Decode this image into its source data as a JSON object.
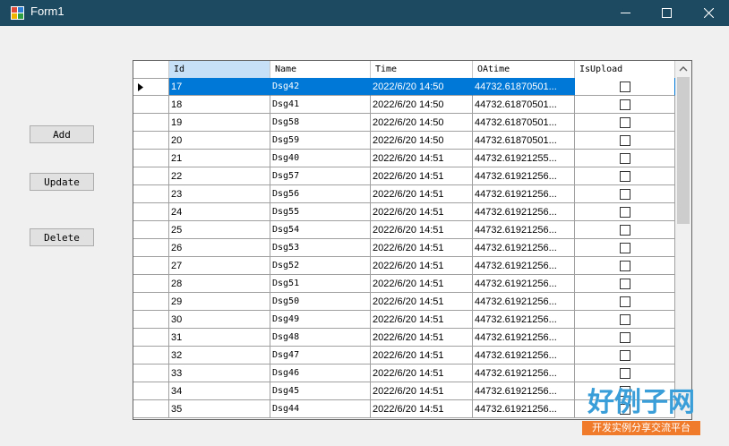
{
  "window": {
    "title": "Form1"
  },
  "buttons": {
    "add": "Add",
    "update": "Update",
    "delete": "Delete"
  },
  "grid": {
    "columns": [
      "Id",
      "Name",
      "Time",
      "OAtime",
      "IsUpload"
    ],
    "rows": [
      {
        "id": "17",
        "name": "Dsg42",
        "time": "2022/6/20 14:50",
        "oatime": "44732.61870501...",
        "isupload": false
      },
      {
        "id": "18",
        "name": "Dsg41",
        "time": "2022/6/20 14:50",
        "oatime": "44732.61870501...",
        "isupload": false
      },
      {
        "id": "19",
        "name": "Dsg58",
        "time": "2022/6/20 14:50",
        "oatime": "44732.61870501...",
        "isupload": false
      },
      {
        "id": "20",
        "name": "Dsg59",
        "time": "2022/6/20 14:50",
        "oatime": "44732.61870501...",
        "isupload": false
      },
      {
        "id": "21",
        "name": "Dsg40",
        "time": "2022/6/20 14:51",
        "oatime": "44732.61921255...",
        "isupload": false
      },
      {
        "id": "22",
        "name": "Dsg57",
        "time": "2022/6/20 14:51",
        "oatime": "44732.61921256...",
        "isupload": false
      },
      {
        "id": "23",
        "name": "Dsg56",
        "time": "2022/6/20 14:51",
        "oatime": "44732.61921256...",
        "isupload": false
      },
      {
        "id": "24",
        "name": "Dsg55",
        "time": "2022/6/20 14:51",
        "oatime": "44732.61921256...",
        "isupload": false
      },
      {
        "id": "25",
        "name": "Dsg54",
        "time": "2022/6/20 14:51",
        "oatime": "44732.61921256...",
        "isupload": false
      },
      {
        "id": "26",
        "name": "Dsg53",
        "time": "2022/6/20 14:51",
        "oatime": "44732.61921256...",
        "isupload": false
      },
      {
        "id": "27",
        "name": "Dsg52",
        "time": "2022/6/20 14:51",
        "oatime": "44732.61921256...",
        "isupload": false
      },
      {
        "id": "28",
        "name": "Dsg51",
        "time": "2022/6/20 14:51",
        "oatime": "44732.61921256...",
        "isupload": false
      },
      {
        "id": "29",
        "name": "Dsg50",
        "time": "2022/6/20 14:51",
        "oatime": "44732.61921256...",
        "isupload": false
      },
      {
        "id": "30",
        "name": "Dsg49",
        "time": "2022/6/20 14:51",
        "oatime": "44732.61921256...",
        "isupload": false
      },
      {
        "id": "31",
        "name": "Dsg48",
        "time": "2022/6/20 14:51",
        "oatime": "44732.61921256...",
        "isupload": false
      },
      {
        "id": "32",
        "name": "Dsg47",
        "time": "2022/6/20 14:51",
        "oatime": "44732.61921256...",
        "isupload": false
      },
      {
        "id": "33",
        "name": "Dsg46",
        "time": "2022/6/20 14:51",
        "oatime": "44732.61921256...",
        "isupload": false
      },
      {
        "id": "34",
        "name": "Dsg45",
        "time": "2022/6/20 14:51",
        "oatime": "44732.61921256...",
        "isupload": false
      },
      {
        "id": "35",
        "name": "Dsg44",
        "time": "2022/6/20 14:51",
        "oatime": "44732.61921256...",
        "isupload": false
      }
    ]
  },
  "watermark": {
    "title": "好例子网",
    "subtitle": "开发实例分享交流平台"
  },
  "colors": {
    "titlebar": "#1d4a61",
    "selection": "#0078d7",
    "header_selected": "#c6e0f7",
    "watermark_blue": "#3a9fd8",
    "watermark_orange": "#f07b2b"
  }
}
